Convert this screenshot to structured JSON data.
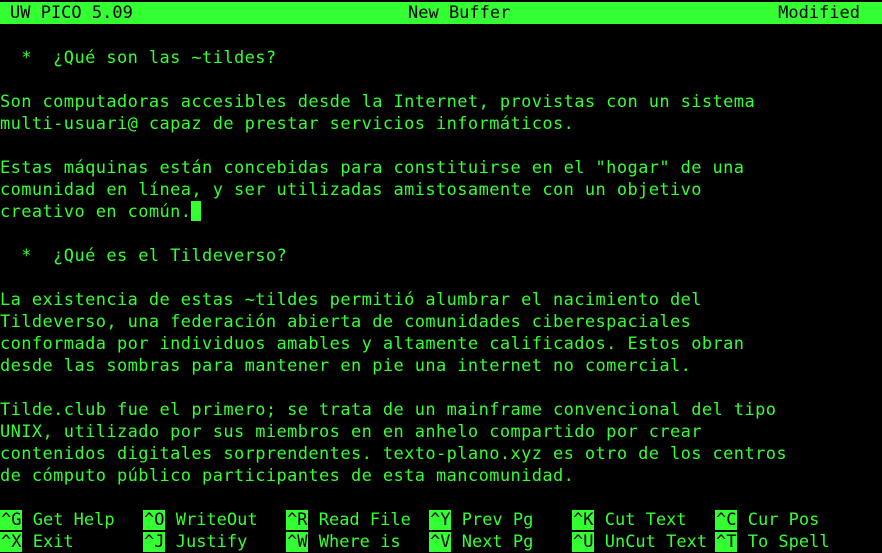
{
  "title_bar": {
    "app_name": "UW PICO 5.09",
    "buffer_name": "New Buffer",
    "status": "Modified"
  },
  "editor": {
    "lines": [
      "  *  ¿Qué son las ~tildes?",
      "",
      "Son computadoras accesibles desde la Internet, provistas con un sistema",
      "multi-usuari@ capaz de prestar servicios informáticos.",
      "",
      "Estas máquinas están concebidas para constituirse en el \"hogar\" de una",
      "comunidad en línea, y ser utilizadas amistosamente con un objetivo",
      "creativo en común.",
      "",
      "  *  ¿Qué es el Tildeverso?",
      "",
      "La existencia de estas ~tildes permitió alumbrar el nacimiento del",
      "Tildeverso, una federación abierta de comunidades ciberespaciales",
      "conformada por individuos amables y altamente calificados. Estos obran",
      "desde las sombras para mantener en pie una internet no comercial.",
      "",
      "Tilde.club fue el primero; se trata de un mainframe convencional del tipo",
      "UNIX, utilizado por sus miembros en en anhelo compartido por crear",
      "contenidos digitales sorprendentes. texto-plano.xyz es otro de los centros",
      "de cómputo público participantes de esta mancomunidad."
    ]
  },
  "shortcuts": {
    "row1": [
      {
        "key": "^G",
        "label": " Get Help"
      },
      {
        "key": "^O",
        "label": " WriteOut"
      },
      {
        "key": "^R",
        "label": " Read File"
      },
      {
        "key": "^Y",
        "label": " Prev Pg"
      },
      {
        "key": "^K",
        "label": " Cut Text"
      },
      {
        "key": "^C",
        "label": " Cur Pos"
      }
    ],
    "row2": [
      {
        "key": "^X",
        "label": " Exit"
      },
      {
        "key": "^J",
        "label": " Justify"
      },
      {
        "key": "^W",
        "label": " Where is"
      },
      {
        "key": "^V",
        "label": " Next Pg"
      },
      {
        "key": "^U",
        "label": " UnCut Text"
      },
      {
        "key": "^T",
        "label": " To Spell"
      }
    ]
  },
  "colors": {
    "foreground": "#33ff33",
    "background": "#000000"
  }
}
